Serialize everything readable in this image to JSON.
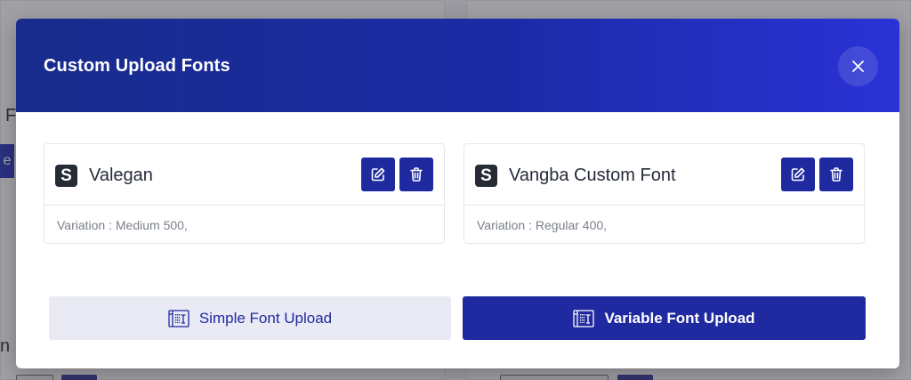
{
  "modal": {
    "title": "Custom Upload Fonts",
    "close_icon": "close-icon"
  },
  "fonts": [
    {
      "logo": "S",
      "name": "Valegan",
      "variation": "Variation : Medium 500,"
    },
    {
      "logo": "S",
      "name": "Vangba Custom Font",
      "variation": "Variation : Regular 400,"
    }
  ],
  "actions": {
    "simple_upload_label": "Simple Font Upload",
    "variable_upload_label": "Variable Font Upload"
  },
  "background": {
    "letter_top": "F",
    "button_fragment": "e",
    "letter_bottom": "n"
  },
  "colors": {
    "header_start": "#182c8c",
    "header_end": "#2a32d6",
    "accent": "#1f2aa0",
    "secondary_button_bg": "#e9eaf4"
  }
}
